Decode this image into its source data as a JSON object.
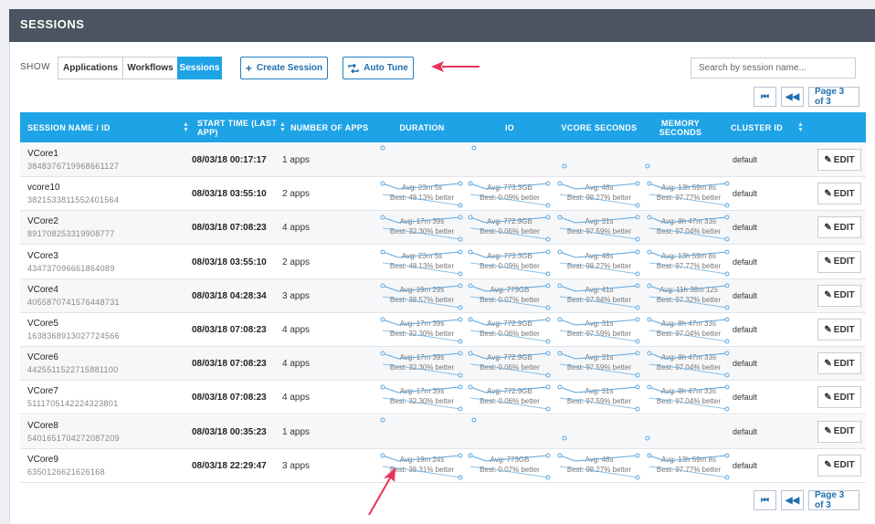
{
  "header": {
    "title": "SESSIONS"
  },
  "toolbar": {
    "show_label": "SHOW",
    "filters": [
      {
        "label": "Applications",
        "active": false
      },
      {
        "label": "Workflows",
        "active": false
      },
      {
        "label": "Sessions",
        "active": true
      }
    ],
    "create_label": "Create Session",
    "autotune_label": "Auto Tune",
    "search_placeholder": "Search by session name..."
  },
  "pagination": {
    "first_icon": "first-page-icon",
    "prev_icon": "prev-page-icon",
    "page_text": "Page 3 of 3"
  },
  "table": {
    "columns": [
      "SESSION NAME / ID",
      "START TIME (LAST APP)",
      "NUMBER OF APPS",
      "DURATION",
      "IO",
      "VCORE SECONDS",
      "MEMORY SECONDS",
      "CLUSTER ID"
    ],
    "edit_label": "EDIT",
    "rows": [
      {
        "name": "VCore1",
        "id": "3848376719968661127",
        "start": "08/03/18 00:17:17",
        "apps": "1 apps",
        "cluster": "default",
        "duration": null,
        "io": null,
        "vcore": null,
        "memory": null
      },
      {
        "name": "vcore10",
        "id": "3821533811552401564",
        "start": "08/03/18 03:55:10",
        "apps": "2 apps",
        "cluster": "default",
        "duration": {
          "avg": "Avg: 23m 5s",
          "best": "Best: 48.13% better"
        },
        "io": {
          "avg": "Avg: 773.3GB",
          "best": "Best: 0.09% better"
        },
        "vcore": {
          "avg": "Avg: 48s",
          "best": "Best: 98.27% better"
        },
        "memory": {
          "avg": "Avg: 13h 59m 8s",
          "best": "Best: 97.77% better"
        }
      },
      {
        "name": "VCore2",
        "id": "891708253319908777",
        "start": "08/03/18 07:08:23",
        "apps": "4 apps",
        "cluster": "default",
        "duration": {
          "avg": "Avg: 17m 39s",
          "best": "Best: 32.30% better"
        },
        "io": {
          "avg": "Avg: 772.9GB",
          "best": "Best: 0.06% better"
        },
        "vcore": {
          "avg": "Avg: 31s",
          "best": "Best: 97.59% better"
        },
        "memory": {
          "avg": "Avg: 8h 47m 33s",
          "best": "Best: 97.04% better"
        }
      },
      {
        "name": "VCore3",
        "id": "434737096661864089",
        "start": "08/03/18 03:55:10",
        "apps": "2 apps",
        "cluster": "default",
        "duration": {
          "avg": "Avg: 23m 5s",
          "best": "Best: 48.13% better"
        },
        "io": {
          "avg": "Avg: 773.3GB",
          "best": "Best: 0.09% better"
        },
        "vcore": {
          "avg": "Avg: 48s",
          "best": "Best: 98.27% better"
        },
        "memory": {
          "avg": "Avg: 13h 59m 8s",
          "best": "Best: 97.77% better"
        }
      },
      {
        "name": "VCore4",
        "id": "4055870741576448731",
        "start": "08/03/18 04:28:34",
        "apps": "3 apps",
        "cluster": "default",
        "duration": {
          "avg": "Avg: 19m 29s",
          "best": "Best: 38.57% better"
        },
        "io": {
          "avg": "Avg: 773GB",
          "best": "Best: 0.07% better"
        },
        "vcore": {
          "avg": "Avg: 41s",
          "best": "Best: 97.94% better"
        },
        "memory": {
          "avg": "Avg: 11h 38m 12s",
          "best": "Best: 97.32% better"
        }
      },
      {
        "name": "VCore5",
        "id": "1638368913027724566",
        "start": "08/03/18 07:08:23",
        "apps": "4 apps",
        "cluster": "default",
        "duration": {
          "avg": "Avg: 17m 39s",
          "best": "Best: 32.30% better"
        },
        "io": {
          "avg": "Avg: 772.9GB",
          "best": "Best: 0.06% better"
        },
        "vcore": {
          "avg": "Avg: 31s",
          "best": "Best: 97.59% better"
        },
        "memory": {
          "avg": "Avg: 8h 47m 33s",
          "best": "Best: 97.04% better"
        }
      },
      {
        "name": "VCore6",
        "id": "4425511522715881100",
        "start": "08/03/18 07:08:23",
        "apps": "4 apps",
        "cluster": "default",
        "duration": {
          "avg": "Avg: 17m 39s",
          "best": "Best: 32.30% better"
        },
        "io": {
          "avg": "Avg: 772.9GB",
          "best": "Best: 0.06% better"
        },
        "vcore": {
          "avg": "Avg: 31s",
          "best": "Best: 97.59% better"
        },
        "memory": {
          "avg": "Avg: 8h 47m 33s",
          "best": "Best: 97.04% better"
        }
      },
      {
        "name": "VCore7",
        "id": "5111705142224323801",
        "start": "08/03/18 07:08:23",
        "apps": "4 apps",
        "cluster": "default",
        "duration": {
          "avg": "Avg: 17m 39s",
          "best": "Best: 32.30% better"
        },
        "io": {
          "avg": "Avg: 772.9GB",
          "best": "Best: 0.06% better"
        },
        "vcore": {
          "avg": "Avg: 31s",
          "best": "Best: 97.59% better"
        },
        "memory": {
          "avg": "Avg: 8h 47m 33s",
          "best": "Best: 97.04% better"
        }
      },
      {
        "name": "VCore8",
        "id": "5401651704272087209",
        "start": "08/03/18 00:35:23",
        "apps": "1 apps",
        "cluster": "default",
        "duration": null,
        "io": null,
        "vcore": null,
        "memory": null
      },
      {
        "name": "VCore9",
        "id": "6350126621626168",
        "start": "08/03/18 22:29:47",
        "apps": "3 apps",
        "cluster": "default",
        "duration": {
          "avg": "Avg: 19m 24s",
          "best": "Best: 38.31% better"
        },
        "io": {
          "avg": "Avg: 773GB",
          "best": "Best: 0.07% better"
        },
        "vcore": {
          "avg": "Avg: 48s",
          "best": "Best: 98.27% better"
        },
        "memory": {
          "avg": "Avg: 13h 59m 8s",
          "best": "Best: 97.77% better"
        }
      }
    ]
  },
  "colors": {
    "header_bar": "#4b5460",
    "table_header": "#1ea3e6",
    "accent": "#1f6fb0",
    "spark": "#5aa6df",
    "annotation_arrow": "#e8335a"
  }
}
